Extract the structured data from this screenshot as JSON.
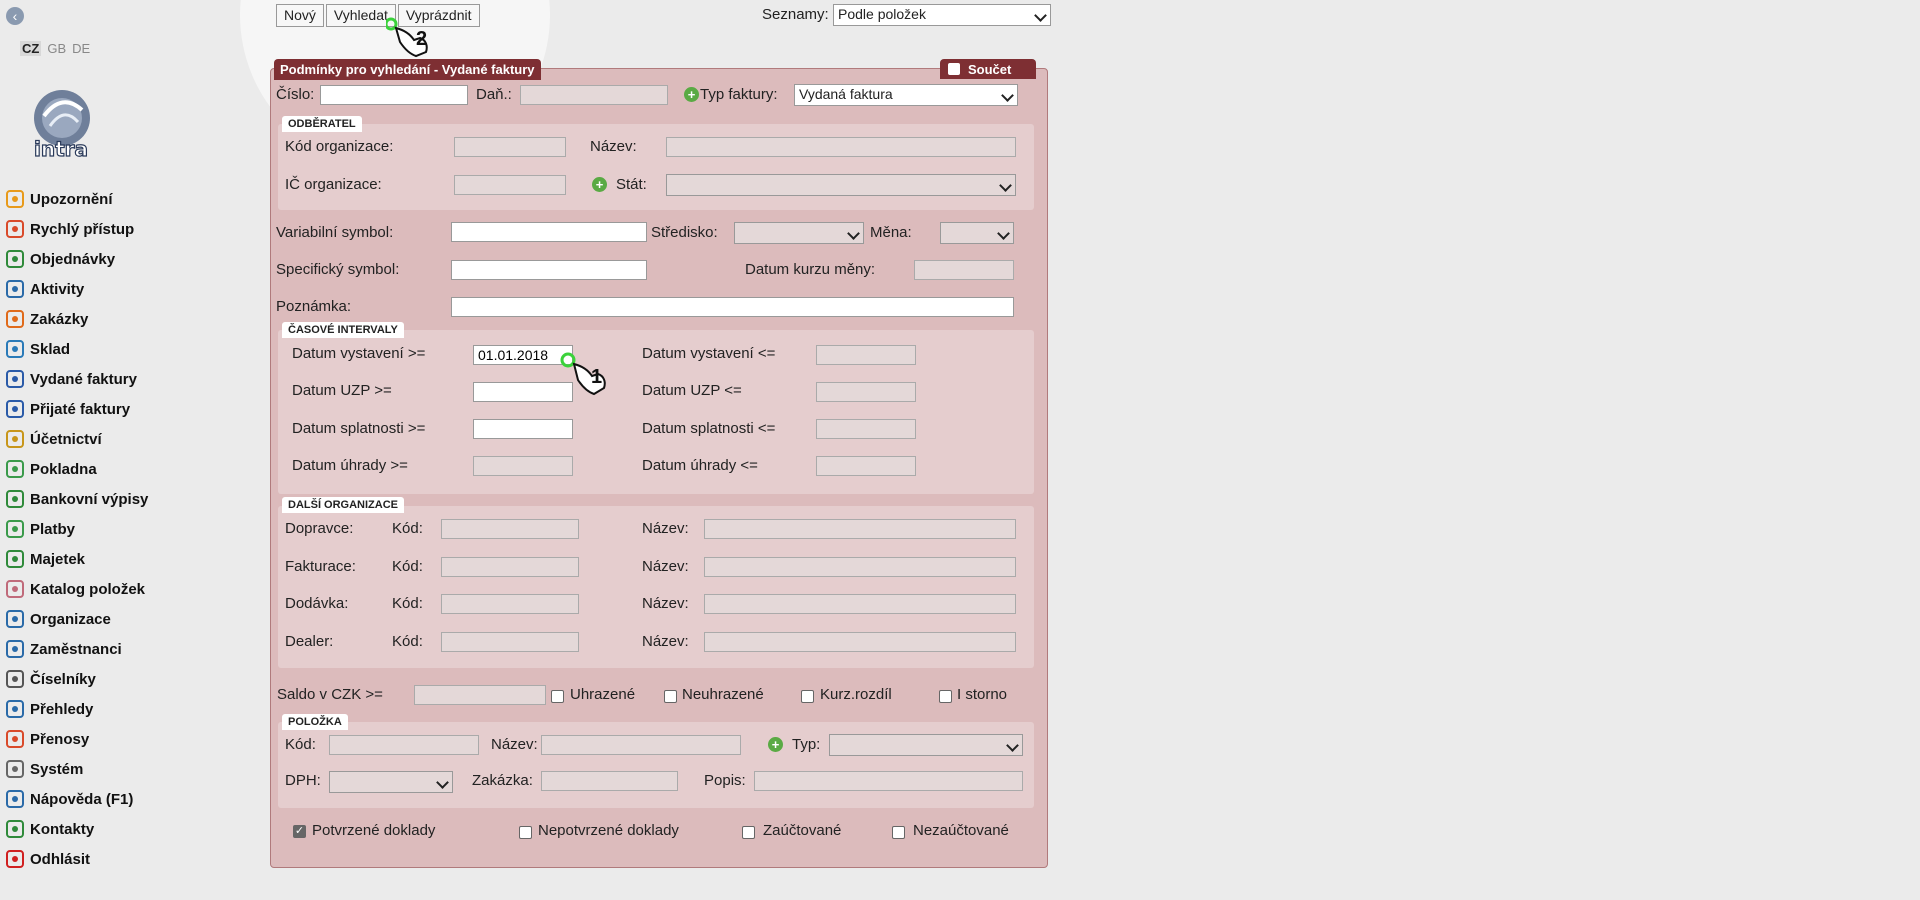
{
  "sidebar": {
    "languages": [
      "CZ",
      "GB",
      "DE"
    ],
    "logo_text": "intra",
    "items": [
      {
        "label": "Upozornění",
        "icon": "bell-icon",
        "color": "#e89a1a"
      },
      {
        "label": "Rychlý přístup",
        "icon": "tiles-icon",
        "color": "#d94a2a"
      },
      {
        "label": "Objednávky",
        "icon": "cart-icon",
        "color": "#2f8a3a"
      },
      {
        "label": "Aktivity",
        "icon": "clock-icon",
        "color": "#2a6aa8"
      },
      {
        "label": "Zakázky",
        "icon": "clipboard-icon",
        "color": "#e06a1a"
      },
      {
        "label": "Sklad",
        "icon": "warehouse-icon",
        "color": "#2a7ab8"
      },
      {
        "label": "Vydané faktury",
        "icon": "invoice-out-icon",
        "color": "#2a5aa8"
      },
      {
        "label": "Přijaté faktury",
        "icon": "invoice-in-icon",
        "color": "#2a5aa8"
      },
      {
        "label": "Účetnictví",
        "icon": "ledger-icon",
        "color": "#c8961a"
      },
      {
        "label": "Pokladna",
        "icon": "cash-icon",
        "color": "#3a9a4a"
      },
      {
        "label": "Bankovní výpisy",
        "icon": "bank-icon",
        "color": "#2f8a3a"
      },
      {
        "label": "Platby",
        "icon": "payment-icon",
        "color": "#3a9a4a"
      },
      {
        "label": "Majetek",
        "icon": "property-icon",
        "color": "#2f8a3a"
      },
      {
        "label": "Katalog položek",
        "icon": "tag-icon",
        "color": "#c06a7a"
      },
      {
        "label": "Organizace",
        "icon": "house-icon",
        "color": "#2a6aa8"
      },
      {
        "label": "Zaměstnanci",
        "icon": "employee-icon",
        "color": "#2a6aa8"
      },
      {
        "label": "Číselníky",
        "icon": "gear-icon",
        "color": "#555555"
      },
      {
        "label": "Přehledy",
        "icon": "list-icon",
        "color": "#2a6aa8"
      },
      {
        "label": "Přenosy",
        "icon": "transfer-icon",
        "color": "#d94a2a"
      },
      {
        "label": "Systém",
        "icon": "wrench-icon",
        "color": "#666666"
      },
      {
        "label": "Nápověda (F1)",
        "icon": "help-icon",
        "color": "#2a6aa8"
      },
      {
        "label": "Kontakty",
        "icon": "at-icon",
        "color": "#2f8a3a"
      },
      {
        "label": "Odhlásit",
        "icon": "power-icon",
        "color": "#d02020"
      }
    ]
  },
  "toolbar": {
    "new": "Nový",
    "search": "Vyhledat",
    "clear": "Vyprázdnit",
    "lists_label": "Seznamy:",
    "lists_value": "Podle položek"
  },
  "panel": {
    "title": "Podmínky pro vyhledání - Vydané faktury",
    "sum_label": "Součet",
    "cislo": "Číslo:",
    "dan": "Daň.:",
    "typ_faktury": "Typ faktury:",
    "typ_faktury_value": "Vydaná faktura",
    "odberatel": {
      "section": "ODBĚRATEL",
      "kod": "Kód organizace:",
      "nazev": "Název:",
      "ic": "IČ organizace:",
      "stat": "Stát:"
    },
    "variabilni": "Variabilní symbol:",
    "stredisko": "Středisko:",
    "mena": "Měna:",
    "specificky": "Specifický symbol:",
    "datum_kurzu": "Datum kurzu měny:",
    "poznamka": "Poznámka:",
    "intervaly": {
      "section": "ČASOVÉ INTERVALY",
      "vystaveni_from": "Datum vystavení >=",
      "vystaveni_from_value": "01.01.2018",
      "vystaveni_to": "Datum vystavení <=",
      "uzp_from": "Datum UZP >=",
      "uzp_to": "Datum UZP <=",
      "splatnosti_from": "Datum splatnosti >=",
      "splatnosti_to": "Datum splatnosti <=",
      "uhrady_from": "Datum úhrady >=",
      "uhrady_to": "Datum úhrady <="
    },
    "dalsi": {
      "section": "DALŠÍ ORGANIZACE",
      "rows": [
        {
          "label": "Dopravce:",
          "kod": "Kód:",
          "nazev": "Název:"
        },
        {
          "label": "Fakturace:",
          "kod": "Kód:",
          "nazev": "Název:"
        },
        {
          "label": "Dodávka:",
          "kod": "Kód:",
          "nazev": "Název:"
        },
        {
          "label": "Dealer:",
          "kod": "Kód:",
          "nazev": "Název:"
        }
      ]
    },
    "saldo": "Saldo v CZK >=",
    "uhrazene": "Uhrazené",
    "neuhrazene": "Neuhrazené",
    "kurz": "Kurz.rozdíl",
    "storno": "I storno",
    "polozka": {
      "section": "POLOŽKA",
      "kod": "Kód:",
      "nazev": "Název:",
      "typ": "Typ:",
      "dph": "DPH:",
      "zakazka": "Zakázka:",
      "popis": "Popis:"
    },
    "potvrzene": "Potvrzené doklady",
    "nepotvrzene": "Nepotvrzené doklady",
    "zauctovane": "Zaúčtované",
    "nezauctovane": "Nezaúčtované"
  },
  "hints": {
    "step1": "1",
    "step2": "2"
  }
}
